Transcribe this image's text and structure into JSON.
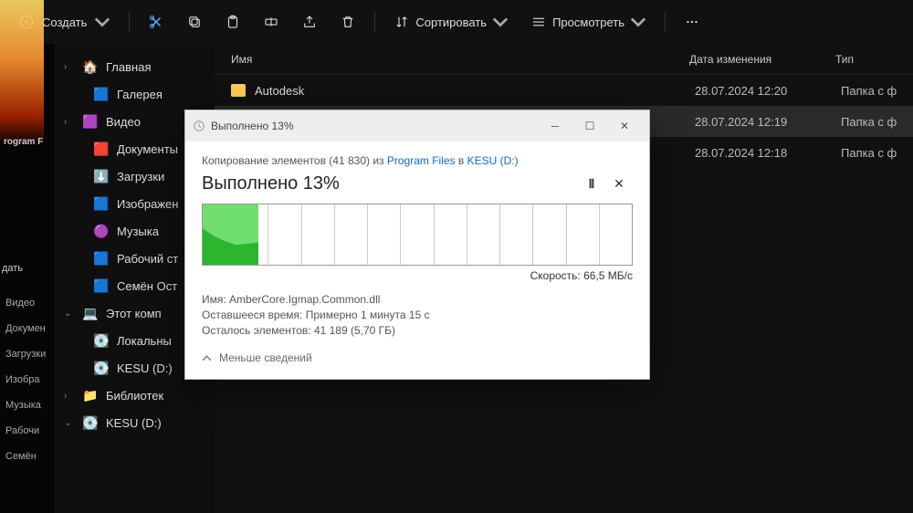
{
  "toolbar": {
    "create_label": "Создать",
    "sort_label": "Сортировать",
    "view_label": "Просмотреть"
  },
  "left_strip": {
    "top_label": "rogram F",
    "action_label": "дать",
    "items": [
      "Видео",
      "Докумен",
      "Загрузки",
      "Изобра",
      "Музыка",
      "Рабочи",
      "Семён"
    ]
  },
  "nav": [
    {
      "icon": "🏠",
      "label": "Главная",
      "chev": true
    },
    {
      "icon": "🟦",
      "label": "Галерея",
      "indent": true
    },
    {
      "icon": "🟪",
      "label": "Видео",
      "chev": true
    },
    {
      "icon": "🟥",
      "label": "Документы",
      "indent": true
    },
    {
      "icon": "⬇️",
      "label": "Загрузки",
      "indent": true
    },
    {
      "icon": "🟦",
      "label": "Изображен",
      "indent": true
    },
    {
      "icon": "🟣",
      "label": "Музыка",
      "indent": true
    },
    {
      "icon": "🟦",
      "label": "Рабочий ст",
      "indent": true
    },
    {
      "icon": "🟦",
      "label": "Семён Ост",
      "indent": true
    },
    {
      "icon": "💻",
      "label": "Этот комп",
      "chev": true,
      "expanded": true
    },
    {
      "icon": "💽",
      "label": "Локальны",
      "indent": true
    },
    {
      "icon": "💽",
      "label": "KESU (D:)",
      "indent": true
    },
    {
      "icon": "📁",
      "label": "Библиотек",
      "chev": true
    },
    {
      "icon": "💽",
      "label": "KESU (D:)",
      "chev": true,
      "expanded": true
    }
  ],
  "columns": {
    "name": "Имя",
    "date": "Дата изменения",
    "type": "Тип"
  },
  "rows": [
    {
      "name": "Autodesk",
      "date": "28.07.2024 12:20",
      "type": "Папка с ф"
    },
    {
      "name": "",
      "date": "28.07.2024 12:19",
      "type": "Папка с ф",
      "selected": true
    },
    {
      "name": "",
      "date": "28.07.2024 12:18",
      "type": "Папка с ф"
    }
  ],
  "dialog": {
    "title": "Выполнено 13%",
    "source_prefix": "Копирование элементов (41 830) из ",
    "source_link": "Program Files",
    "source_mid": " в ",
    "dest_link": "KESU (D:)",
    "heading": "Выполнено 13%",
    "speed_label": "Скорость: ",
    "speed_value": "66,5 МБ/с",
    "name_label": "Имя: ",
    "name_value": "AmberCore.Igmap.Common.dll",
    "time_label": "Оставшееся время: ",
    "time_value": "Примерно 1 минута 15 с",
    "remain_label": "Осталось элементов: ",
    "remain_value": "41 189 (5,70 ГБ)",
    "less_label": "Меньше сведений"
  },
  "chart_data": {
    "type": "area",
    "title": "Выполнено 13%",
    "progress_percent": 13,
    "speed_current": 66.5,
    "speed_unit": "МБ/с",
    "ylim": [
      0,
      100
    ],
    "x_segments": 13,
    "series": [
      {
        "name": "transfer_speed_history",
        "values": [
          95,
          80,
          70,
          62,
          58,
          62,
          66
        ]
      }
    ]
  }
}
